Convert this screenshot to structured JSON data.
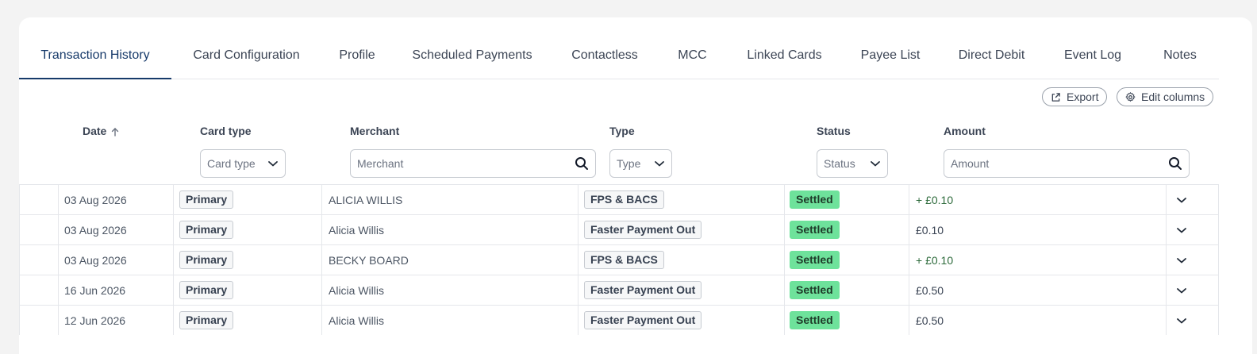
{
  "tabs": [
    {
      "label": "Transaction History",
      "active": true
    },
    {
      "label": "Card Configuration"
    },
    {
      "label": "Profile"
    },
    {
      "label": "Scheduled Payments"
    },
    {
      "label": "Contactless"
    },
    {
      "label": "MCC"
    },
    {
      "label": "Linked Cards"
    },
    {
      "label": "Payee List"
    },
    {
      "label": "Direct Debit"
    },
    {
      "label": "Event Log"
    },
    {
      "label": "Notes"
    }
  ],
  "toolbar": {
    "export_label": "Export",
    "edit_columns_label": "Edit columns"
  },
  "columns": {
    "date": "Date",
    "card_type": "Card type",
    "merchant": "Merchant",
    "type": "Type",
    "status": "Status",
    "amount": "Amount"
  },
  "filters": {
    "card_type": "Card type",
    "merchant_placeholder": "Merchant",
    "type": "Type",
    "status": "Status",
    "amount_placeholder": "Amount"
  },
  "rows": [
    {
      "date": "03 Aug 2026",
      "card_type": "Primary",
      "merchant": "ALICIA WILLIS",
      "type": "FPS & BACS",
      "status": "Settled",
      "amount": "+ £0.10",
      "credit": true
    },
    {
      "date": "03 Aug 2026",
      "card_type": "Primary",
      "merchant": "Alicia Willis",
      "type": "Faster Payment Out",
      "status": "Settled",
      "amount": "£0.10",
      "credit": false
    },
    {
      "date": "03 Aug 2026",
      "card_type": "Primary",
      "merchant": "BECKY BOARD",
      "type": "FPS & BACS",
      "status": "Settled",
      "amount": "+ £0.10",
      "credit": true
    },
    {
      "date": "16 Jun 2026",
      "card_type": "Primary",
      "merchant": "Alicia Willis",
      "type": "Faster Payment Out",
      "status": "Settled",
      "amount": "£0.50",
      "credit": false
    },
    {
      "date": "12 Jun 2026",
      "card_type": "Primary",
      "merchant": "Alicia Willis",
      "type": "Faster Payment Out",
      "status": "Settled",
      "amount": "£0.50",
      "credit": false
    }
  ],
  "colors": {
    "accent": "#173a6a",
    "settled": "#6ee29b",
    "credit_text": "#2e6b3c"
  }
}
